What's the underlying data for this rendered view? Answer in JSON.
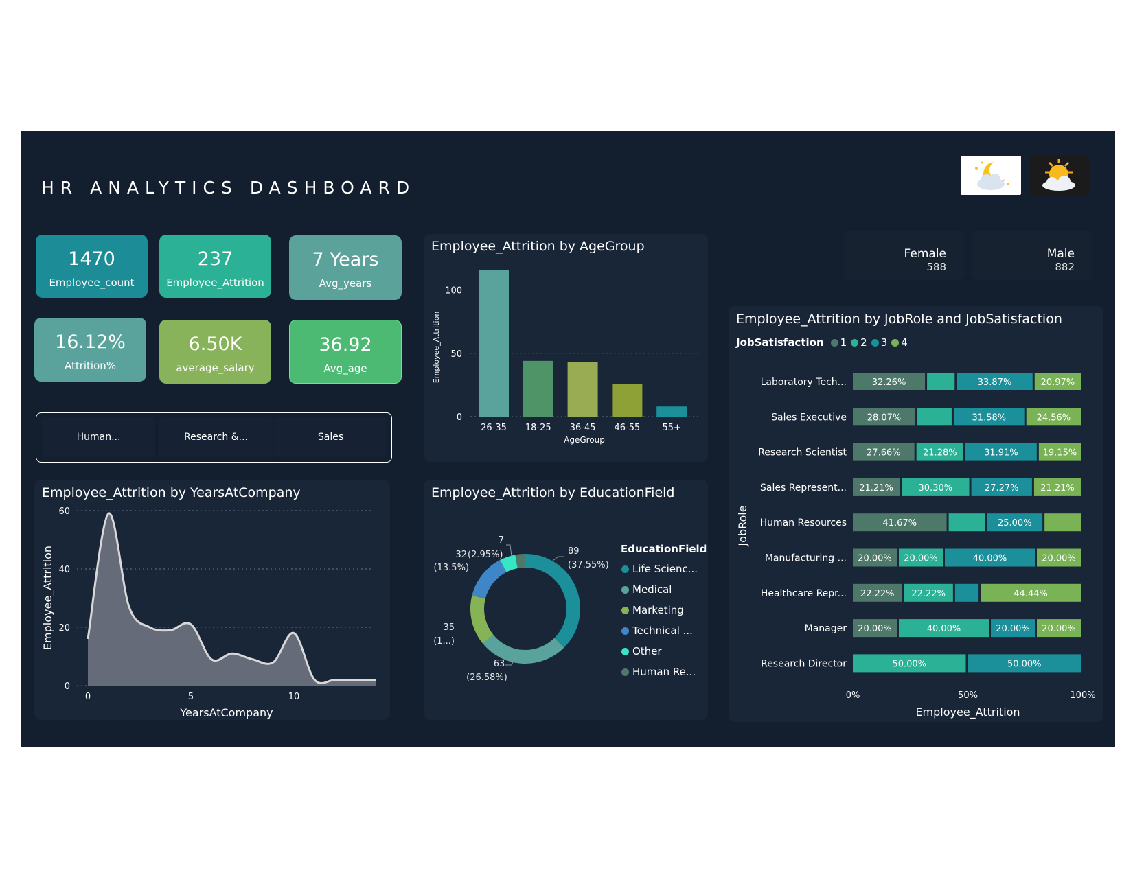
{
  "header": {
    "title": "HR  ANALYTICS  DASHBOARD"
  },
  "theme_toggle": {
    "night": "moon-cloud-icon",
    "day": "sun-cloud-icon"
  },
  "kpis": [
    {
      "value": "1470",
      "label": "Employee_count",
      "color": "#1c8c96"
    },
    {
      "value": "237",
      "label": "Employee_Attrition",
      "color": "#2bb195"
    },
    {
      "value": "7 Years",
      "label": "Avg_years",
      "color": "#5ba29b"
    },
    {
      "value": "16.12%",
      "label": "Attrition%",
      "color": "#5aa39c"
    },
    {
      "value": "6.50K",
      "label": "average_salary",
      "color": "#89b35a"
    },
    {
      "value": "36.92",
      "label": "Avg_age",
      "color": "#4cba73"
    }
  ],
  "department_slicer": {
    "items": [
      "Human...",
      "Research &...",
      "Sales"
    ]
  },
  "gender": [
    {
      "label": "Female",
      "value": "588"
    },
    {
      "label": "Male",
      "value": "882"
    }
  ],
  "chart_data": [
    {
      "type": "bar",
      "title": "Employee_Attrition by AgeGroup",
      "xlabel": "AgeGroup",
      "ylabel": "Employee_Attrition",
      "categories": [
        "26-35",
        "18-25",
        "36-45",
        "46-55",
        "55+"
      ],
      "values": [
        116,
        44,
        43,
        26,
        8
      ],
      "colors": [
        "#5aa39c",
        "#4e9466",
        "#9aac53",
        "#8ea136",
        "#1b8f9a"
      ],
      "ylim": [
        0,
        116
      ],
      "yticks": [
        0,
        50,
        100
      ],
      "grid": true
    },
    {
      "type": "area",
      "title": "Employee_Attrition by YearsAtCompany",
      "xlabel": "YearsAtCompany",
      "ylabel": "Employee_Attrition",
      "x": [
        0,
        1,
        2,
        3,
        4,
        5,
        6,
        7,
        8,
        9,
        10,
        11,
        12,
        13,
        14
      ],
      "y": [
        16,
        59,
        27,
        20,
        19,
        21,
        9,
        11,
        9,
        8,
        18,
        2,
        2,
        2,
        2
      ],
      "xticks": [
        0,
        5,
        10
      ],
      "yticks": [
        0,
        20,
        40,
        60
      ],
      "ylim": [
        0,
        60
      ],
      "grid": true
    },
    {
      "type": "pie",
      "title": "Employee_Attrition by EducationField",
      "legend_title": "EducationField",
      "legend_placement": "right",
      "categories": [
        "Life Scienc...",
        "Medical",
        "Marketing",
        "Technical ...",
        "Other",
        "Human Re..."
      ],
      "values": [
        89,
        63,
        35,
        32,
        11,
        7
      ],
      "colors": [
        "#1b8f9a",
        "#5aa39c",
        "#86b356",
        "#3f86c8",
        "#36e6c4",
        "#4e7869"
      ],
      "data_labels": [
        {
          "count": "89",
          "pct": "(37.55%)"
        },
        {
          "count": "63",
          "pct": "(26.58%)"
        },
        {
          "count": "35",
          "pct": "(1...)"
        },
        {
          "count": "32",
          "pct": "(13.5%)"
        },
        {
          "count": "",
          "pct": "(2.95%)"
        },
        {
          "count": "7",
          "pct": ""
        }
      ]
    },
    {
      "type": "bar",
      "subtype": "100% stacked horizontal",
      "title": "Employee_Attrition by JobRole and JobSatisfaction",
      "xlabel": "Employee_Attrition",
      "ylabel": "JobRole",
      "legend_title": "JobSatisfaction",
      "legend_placement": "top-left",
      "xticks": [
        "0%",
        "50%",
        "100%"
      ],
      "categories": [
        "Laboratory Tech...",
        "Sales Executive",
        "Research Scientist",
        "Sales Represent...",
        "Human Resources",
        "Manufacturing ...",
        "Healthcare Repr...",
        "Manager",
        "Research Director"
      ],
      "series": [
        {
          "name": "1",
          "color": "#4e7869",
          "values": [
            32.26,
            28.07,
            27.66,
            21.21,
            41.67,
            20.0,
            22.22,
            20.0,
            0
          ],
          "labels": [
            "32.26%",
            "28.07%",
            "27.66%",
            "21.21%",
            "41.67%",
            "20.00%",
            "22.22%",
            "20.00%",
            ""
          ]
        },
        {
          "name": "2",
          "color": "#2bb195",
          "values": [
            12.9,
            15.79,
            21.28,
            30.3,
            16.66,
            20.0,
            22.22,
            40.0,
            50.0
          ],
          "labels": [
            "",
            "",
            "21.28%",
            "30.30%",
            "",
            "20.00%",
            "22.22%",
            "40.00%",
            "50.00%"
          ]
        },
        {
          "name": "3",
          "color": "#1b8f9a",
          "values": [
            33.87,
            31.58,
            31.91,
            27.27,
            25.0,
            40.0,
            11.12,
            20.0,
            50.0
          ],
          "labels": [
            "33.87%",
            "31.58%",
            "31.91%",
            "27.27%",
            "25.00%",
            "40.00%",
            "",
            "20.00%",
            "50.00%"
          ]
        },
        {
          "name": "4",
          "color": "#7ab356",
          "values": [
            20.97,
            24.56,
            19.15,
            21.21,
            16.67,
            20.0,
            44.44,
            20.0,
            0
          ],
          "labels": [
            "20.97%",
            "24.56%",
            "19.15%",
            "21.21%",
            "",
            "20.00%",
            "44.44%",
            "20.00%",
            ""
          ]
        }
      ]
    }
  ]
}
